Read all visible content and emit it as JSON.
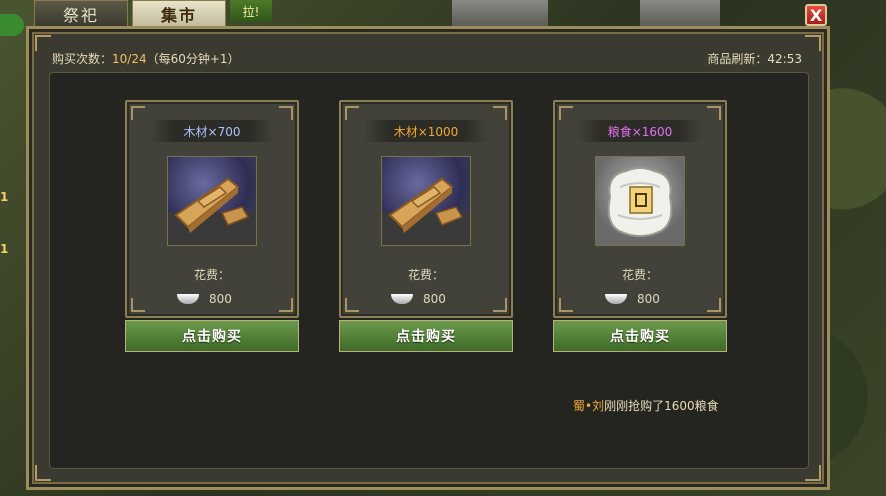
{
  "tabs": [
    {
      "label": "祭祀",
      "active": false
    },
    {
      "label": "集市",
      "active": true
    }
  ],
  "tab_extra": "拉!",
  "close_label": "X",
  "left_badges": [
    "1",
    "1"
  ],
  "header": {
    "buy_count_label": "购买次数：",
    "buy_count_value": "10/24",
    "buy_count_note": "（每60分钟+1）",
    "refresh_label": "商品刷新：",
    "refresh_time": "42:53"
  },
  "items": [
    {
      "title": "木材×700",
      "title_color": "#a9c0ff",
      "icon": "wood-icon",
      "cost_label": "花费：",
      "cost": "800",
      "buy_label": "点击购买"
    },
    {
      "title": "木材×1000",
      "title_color": "#f0a830",
      "icon": "wood-icon",
      "cost_label": "花费：",
      "cost": "800",
      "buy_label": "点击购买"
    },
    {
      "title": "粮食×1600",
      "title_color": "#e070f0",
      "icon": "grain-sack-icon",
      "cost_label": "花费：",
      "cost": "800",
      "buy_label": "点击购买"
    }
  ],
  "news": {
    "who": "蜀•刘",
    "msg": "刚刚抢购了1600粮食"
  },
  "colors": {
    "panel_border": "#9d8d5b",
    "button_green": "#5b8a3d",
    "highlight": "#f0c060"
  }
}
